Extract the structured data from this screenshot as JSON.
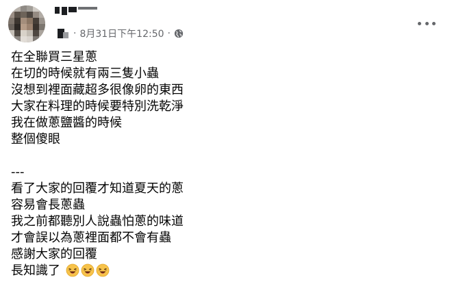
{
  "post": {
    "timestamp": "8月31日下午12:50",
    "separator": "·",
    "privacy_icon": "globe-icon",
    "more_icon": "more-options-icon",
    "lines_part1": [
      "在全聯買三星蔥",
      "在切的時候就有兩三隻小蟲",
      "沒想到裡面藏超多很像卵的東西",
      "大家在料理的時候要特別洗乾淨",
      "我在做蔥鹽醬的時候",
      "整個傻眼"
    ],
    "divider": "---",
    "lines_part2": [
      "看了大家的回覆才知道夏天的蔥",
      "容易會長蔥蟲",
      "我之前都聽別人說蟲怕蔥的味道",
      "才會誤以為蔥裡面都不會有蟲",
      "感謝大家的回覆",
      "長知識了"
    ],
    "last_line_emoji": [
      "laughing-emoji",
      "laughing-emoji",
      "laughing-emoji"
    ]
  },
  "colors": {
    "text": "#050505",
    "secondary": "#65676b",
    "emoji_face": "#f7c34b"
  }
}
